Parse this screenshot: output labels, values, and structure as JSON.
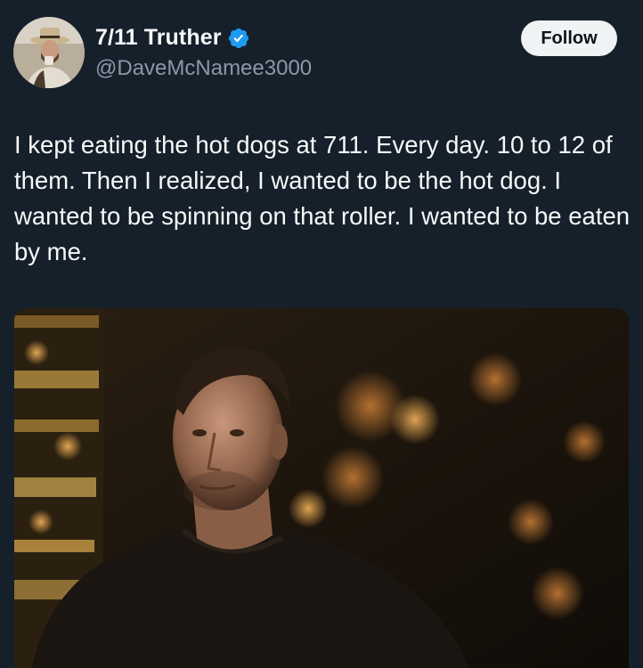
{
  "author": {
    "display_name": "7/11 Truther",
    "handle": "@DaveMcNamee3000",
    "verified": true
  },
  "actions": {
    "follow_label": "Follow"
  },
  "tweet": {
    "text": "I kept eating the hot dogs at 711. Every day. 10 to 12 of them. Then I realized, I wanted to be the hot dog. I wanted to be spinning on that roller. I wanted to be eaten by me."
  },
  "media": {
    "type": "photo"
  },
  "colors": {
    "background": "#15202b",
    "verified_badge": "#1d9bf0",
    "follow_button": "#eff3f4",
    "handle_text": "#8b98a5"
  },
  "icons": {
    "verified": "verified-badge-icon"
  }
}
